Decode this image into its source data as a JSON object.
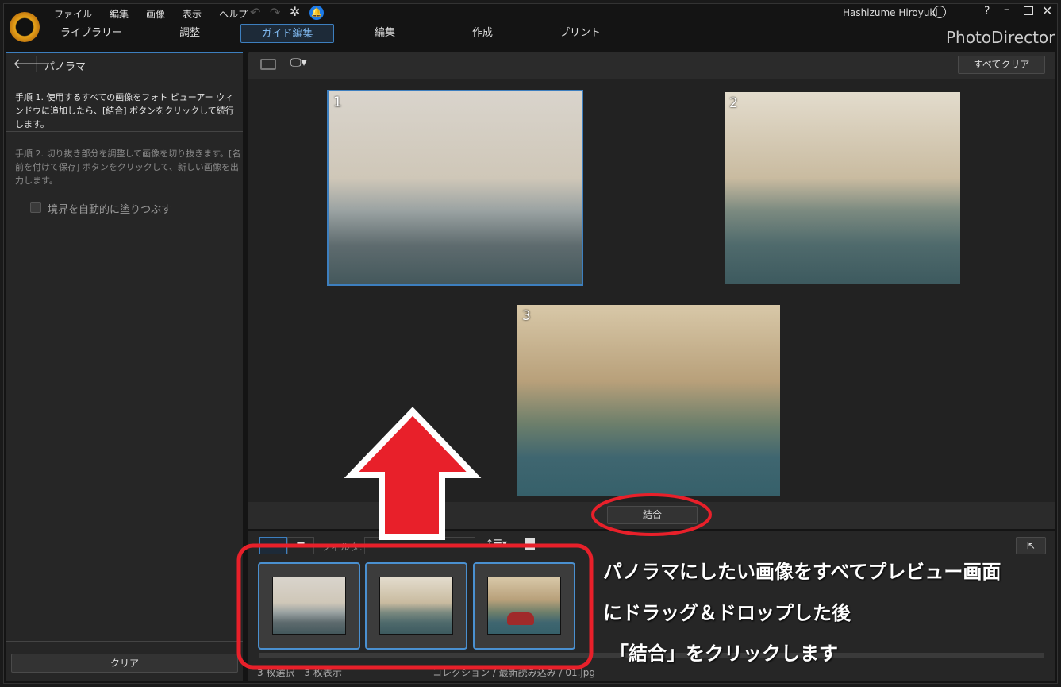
{
  "app": {
    "name": "PhotoDirector",
    "user": "Hashizume Hiroyuki"
  },
  "menu": [
    "ファイル",
    "編集",
    "画像",
    "表示",
    "ヘルプ"
  ],
  "tabs": [
    {
      "label": "ライブラリー"
    },
    {
      "label": "調整"
    },
    {
      "label": "ガイド編集",
      "active": true
    },
    {
      "label": "編集"
    },
    {
      "label": "作成"
    },
    {
      "label": "プリント"
    }
  ],
  "sidebar": {
    "title": "パノラマ",
    "step1": "手順 1. 使用するすべての画像をフォト ビューアー ウィンドウに追加したら、[結合] ボタンをクリックして続行します。",
    "step2": "手順 2. 切り抜き部分を調整して画像を切り抜きます。[名前を付けて保存] ボタンをクリックして、新しい画像を出力します。",
    "checkbox_label": "境界を自動的に塗りつぶす",
    "checkbox_checked": false,
    "clear_label": "クリア"
  },
  "viewer": {
    "clear_all_label": "すべてクリア",
    "photos": [
      {
        "num": "1",
        "selected": true
      },
      {
        "num": "2"
      },
      {
        "num": "3"
      }
    ],
    "merge_label": "結合"
  },
  "filmstrip": {
    "filter_label": "フィルタ:",
    "status_left": "3 枚選択 - 3 枚表示",
    "status_right": "コレクション / 最新読み込み / 01.jpg"
  },
  "annotation": {
    "lines": [
      "パノラマにしたい画像をすべてプレビュー画面",
      "にドラッグ＆ドロップした後",
      "「結合」をクリックします"
    ],
    "color": "#e8202a"
  },
  "colors": {
    "accent": "#3d7fbf",
    "bell": "#1e7be8"
  }
}
